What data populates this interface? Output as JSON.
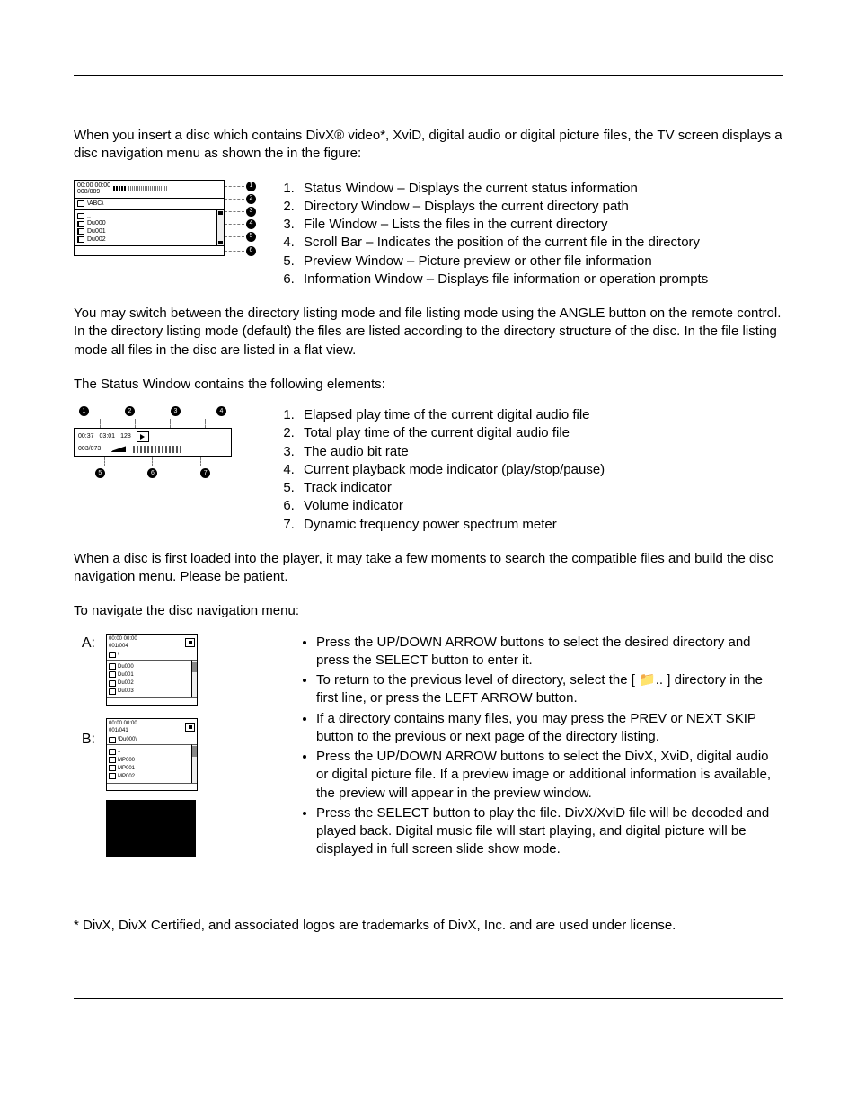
{
  "intro": "When you insert a disc which contains DivX® video*, XviD, digital audio or digital picture files, the TV screen displays a disc navigation menu as shown the in the figure:",
  "navFig": {
    "status_time": "00:00  00:00",
    "status_track": "008/089",
    "dir_path": "\\ABC\\",
    "files": [
      "..",
      "Du000",
      "Du001",
      "Du002"
    ]
  },
  "navList": [
    "Status Window – Displays the current status information",
    "Directory Window – Displays the current directory path",
    "File Window – Lists the files in the current directory",
    "Scroll Bar – Indicates the position of the current file in the directory",
    "Preview Window – Picture preview or other file information",
    "Information Window – Displays file information or operation prompts"
  ],
  "para_switch": "You may switch between the directory listing mode and file listing mode using the ANGLE button on the remote control.  In the directory listing mode (default) the files are listed according to the directory structure of the disc.  In the file listing mode all files in the disc are listed in a flat view.",
  "para_status_intro": "The Status Window contains the following elements:",
  "swFig": {
    "elapsed": "00:37",
    "total": "03:01",
    "bitrate": "128",
    "track": "003/073"
  },
  "swList": [
    "Elapsed play time of the current digital audio file",
    "Total play time of the current digital audio file",
    "The audio bit rate",
    "Current playback mode indicator (play/stop/pause)",
    "Track indicator",
    "Volume indicator",
    "Dynamic frequency power spectrum meter"
  ],
  "para_loading": "When a disc is first loaded into the player, it may take a few moments to search the compatible files and build the disc navigation menu.  Please be patient.",
  "para_navigate": "To navigate the disc navigation menu:",
  "steps": {
    "A": {
      "label": "A:",
      "hdr": "00:00  00:00",
      "sub": "001/004",
      "path": "\\",
      "items": [
        "Du000",
        "Du001",
        "Du002",
        "Du003"
      ],
      "icon": "folder"
    },
    "B": {
      "label": "B:",
      "hdr": "00:00  00:00",
      "sub": "001/041",
      "path": "\\Du000\\",
      "items": [
        "..",
        "MP000",
        "MP001",
        "MP002"
      ],
      "icon": "doc"
    }
  },
  "bullets": [
    "Press the UP/DOWN ARROW buttons to select the desired directory and press the SELECT button to enter it.",
    "To return to the previous level of directory, select the [ 📁.. ] directory in the first line, or press the LEFT ARROW button.",
    "If a directory contains many files, you may press the PREV or NEXT SKIP button to the previous or next page of the directory listing.",
    "Press the UP/DOWN ARROW buttons to select the DivX, XviD, digital audio or digital picture file.  If a preview image or additional information is available, the preview will appear in the preview window.",
    "Press the SELECT button to play the file.  DivX/XviD file will be decoded and played back.  Digital music file will start playing, and digital picture will be displayed in full screen slide show mode."
  ],
  "footnote": "* DivX, DivX Certified, and associated logos are trademarks of DivX, Inc. and are used under license."
}
